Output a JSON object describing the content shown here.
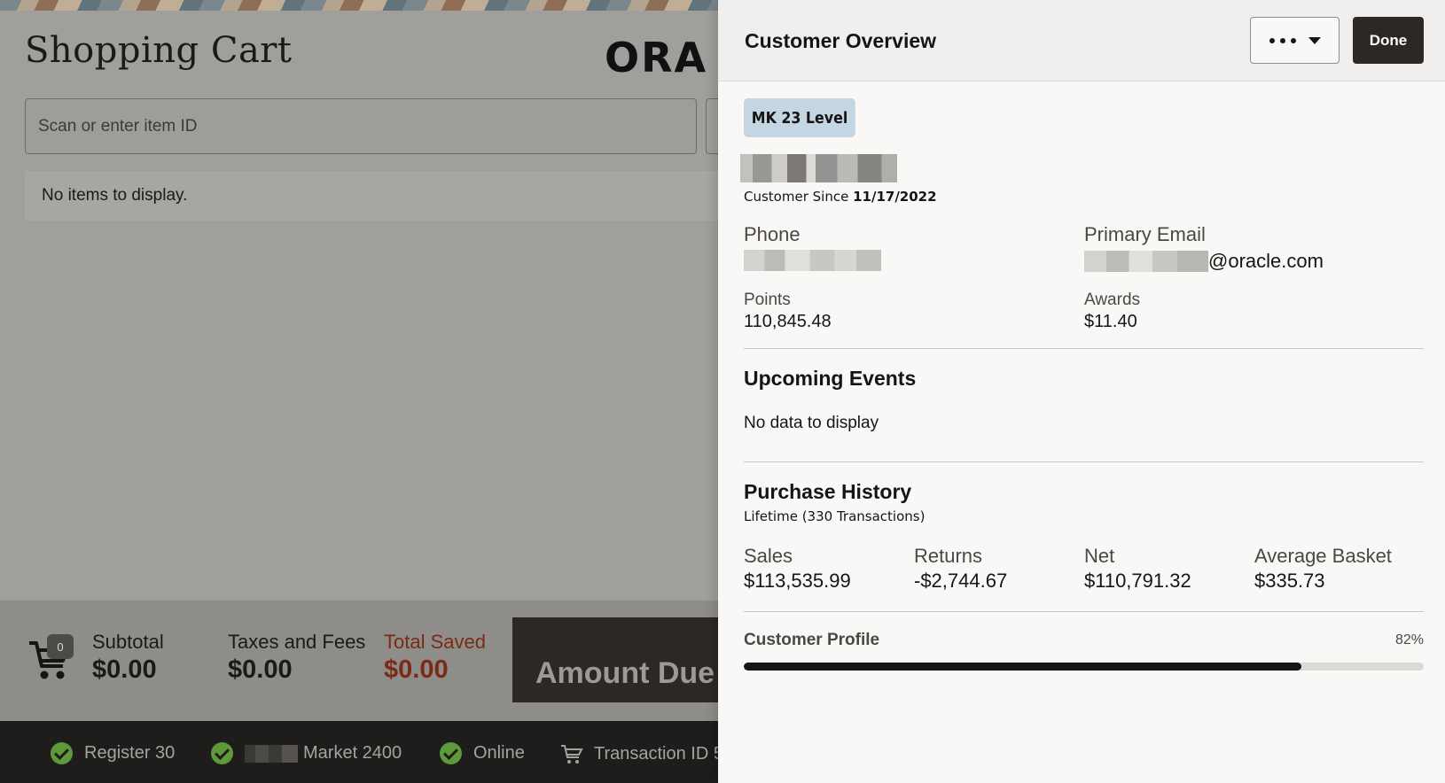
{
  "background": {
    "page_title": "Shopping Cart",
    "logo_text": "ORA",
    "scan_placeholder": "Scan or enter item ID",
    "empty_message": "No items to display.",
    "cart_count": "0",
    "subtotal_label": "Subtotal",
    "subtotal_value": "$0.00",
    "taxes_label": "Taxes and Fees",
    "taxes_value": "$0.00",
    "saved_label": "Total Saved",
    "saved_value": "$0.00",
    "amount_due_label": "Amount Due",
    "status": {
      "register": "Register 30",
      "market": "Market 2400",
      "online": "Online",
      "transaction": "Transaction ID 5"
    }
  },
  "drawer": {
    "title": "Customer Overview",
    "done_label": "Done",
    "level_badge": "MK 23 Level",
    "customer_since_label": "Customer Since",
    "customer_since_date": "11/17/2022",
    "phone_label": "Phone",
    "email_label": "Primary Email",
    "email_domain": "@oracle.com",
    "points_label": "Points",
    "points_value": "110,845.48",
    "awards_label": "Awards",
    "awards_value": "$11.40",
    "events_title": "Upcoming Events",
    "events_empty": "No data to display",
    "history_title": "Purchase History",
    "history_sub": "Lifetime (330 Transactions)",
    "history": [
      {
        "label": "Sales",
        "value": "$113,535.99"
      },
      {
        "label": "Returns",
        "value": "-$2,744.67"
      },
      {
        "label": "Net",
        "value": "$110,791.32"
      },
      {
        "label": "Average Basket",
        "value": "$335.73"
      }
    ],
    "profile_label": "Customer Profile",
    "profile_pct_text": "82%",
    "profile_fraction": 0.82
  },
  "colors": {
    "accent_dark": "#2b2826",
    "saved_red": "#7a2b14",
    "check_green": "#5e9a3a",
    "level_badge_bg": "#c5d6e3"
  },
  "icons": [
    "cart-icon",
    "check-circle-icon",
    "more-dots-icon",
    "chevron-down-icon",
    "cart-outline-icon"
  ]
}
